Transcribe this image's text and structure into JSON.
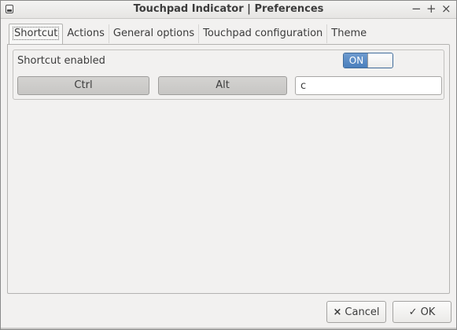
{
  "window": {
    "title": "Touchpad Indicator | Preferences",
    "controls": {
      "minimize": "−",
      "maximize": "+",
      "close": "×"
    }
  },
  "tabs": [
    {
      "label": "Shortcut",
      "active": true
    },
    {
      "label": "Actions",
      "active": false
    },
    {
      "label": "General options",
      "active": false
    },
    {
      "label": "Touchpad configuration",
      "active": false
    },
    {
      "label": "Theme",
      "active": false
    }
  ],
  "shortcut": {
    "enabled_label": "Shortcut enabled",
    "switch_state": "ON",
    "ctrl_label": "Ctrl",
    "alt_label": "Alt",
    "key_value": "c"
  },
  "footer": {
    "cancel_label": "Cancel",
    "ok_label": "OK",
    "cancel_icon": "×",
    "ok_icon": "✓"
  },
  "colors": {
    "switch_on": "#4a7fbd",
    "window_bg": "#f2f1f0"
  }
}
